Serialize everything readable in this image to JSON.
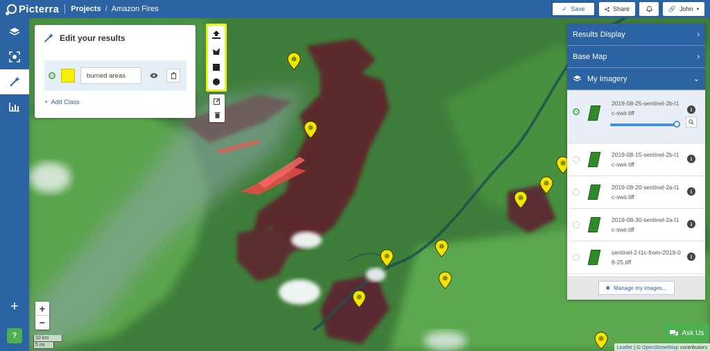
{
  "topbar": {
    "logo_text": "Picterra",
    "breadcrumb_projects": "Projects",
    "breadcrumb_current": "Amazon Fires",
    "save_label": "Save",
    "share_label": "Share",
    "user_label": "John"
  },
  "edit_panel": {
    "title": "Edit your results",
    "class_name": "burned areas",
    "class_color": "#f7f000",
    "add_class_label": "Add Class"
  },
  "right_panel": {
    "results_display": "Results Display",
    "base_map": "Base Map",
    "my_imagery": "My Imagery",
    "images": [
      {
        "name": "2019-08-25-sentinel-2b-l1c-swir.tiff",
        "selected": true,
        "opacity_percent": 100
      },
      {
        "name": "2019-08-15-sentinel-2b-l1c-swir.tiff",
        "selected": false
      },
      {
        "name": "2019-08-20-sentinel-2a-l1c-swir.tiff",
        "selected": false
      },
      {
        "name": "2019-08-30-sentinel-2a-l1c-swir.tiff",
        "selected": false
      },
      {
        "name": "sentinel-2-l1c-from-2019-08-25.tiff",
        "selected": false
      }
    ],
    "manage_label": "Manage my images..."
  },
  "map": {
    "zoom_in": "+",
    "zoom_out": "−",
    "scale_km": "10 km",
    "scale_mi": "5 mi",
    "attribution_leaflet": "Leaflet",
    "attribution_sep": " | © ",
    "attribution_osm": "OpenStreetMap",
    "attribution_tail": " contributors",
    "pin_color": "#f2e600"
  },
  "help_label": "?",
  "ask_us_label": "Ask Us"
}
